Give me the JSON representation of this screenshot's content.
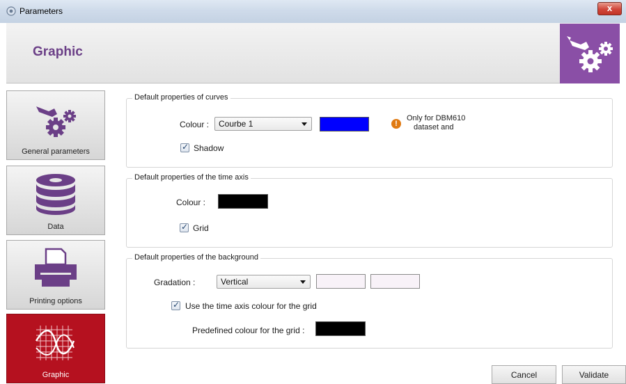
{
  "window": {
    "title": "Parameters",
    "close_label": "x",
    "app_icon": "settings-app-icon"
  },
  "header": {
    "title": "Graphic",
    "logo_icon": "wrench-gears-icon",
    "accent_color": "#8a4fa6",
    "title_color": "#6b3f87"
  },
  "sidebar": {
    "items": [
      {
        "label": "General parameters",
        "icon": "wrench-gears-icon",
        "active": false
      },
      {
        "label": "Data",
        "icon": "database-icon",
        "active": false
      },
      {
        "label": "Printing options",
        "icon": "printer-icon",
        "active": false
      },
      {
        "label": "Graphic",
        "icon": "graph-curve-icon",
        "active": true,
        "active_color": "#b5111f"
      }
    ]
  },
  "curves": {
    "title": "Default properties of curves",
    "colour_label": "Colour :",
    "curve_select": "Courbe 1",
    "colour_value": "#0000ff",
    "shadow_label": "Shadow",
    "shadow_checked": true,
    "info_icon": "warning-icon",
    "info_line1": "Only for DBM610",
    "info_line2": "dataset and"
  },
  "time_axis": {
    "title": "Default properties of the time axis",
    "colour_label": "Colour :",
    "colour_value": "#000000",
    "grid_label": "Grid",
    "grid_checked": true
  },
  "background": {
    "title": "Default properties of the background",
    "gradation_label": "Gradation :",
    "gradation_select": "Vertical",
    "colour1": "#f8f2f8",
    "colour2": "#f8f2f8",
    "use_axis_colour_label": "Use the time axis colour for the grid",
    "use_axis_colour_checked": true,
    "predefined_label": "Predefined colour for the grid :",
    "predefined_colour": "#000000"
  },
  "buttons": {
    "cancel": "Cancel",
    "validate": "Validate"
  }
}
